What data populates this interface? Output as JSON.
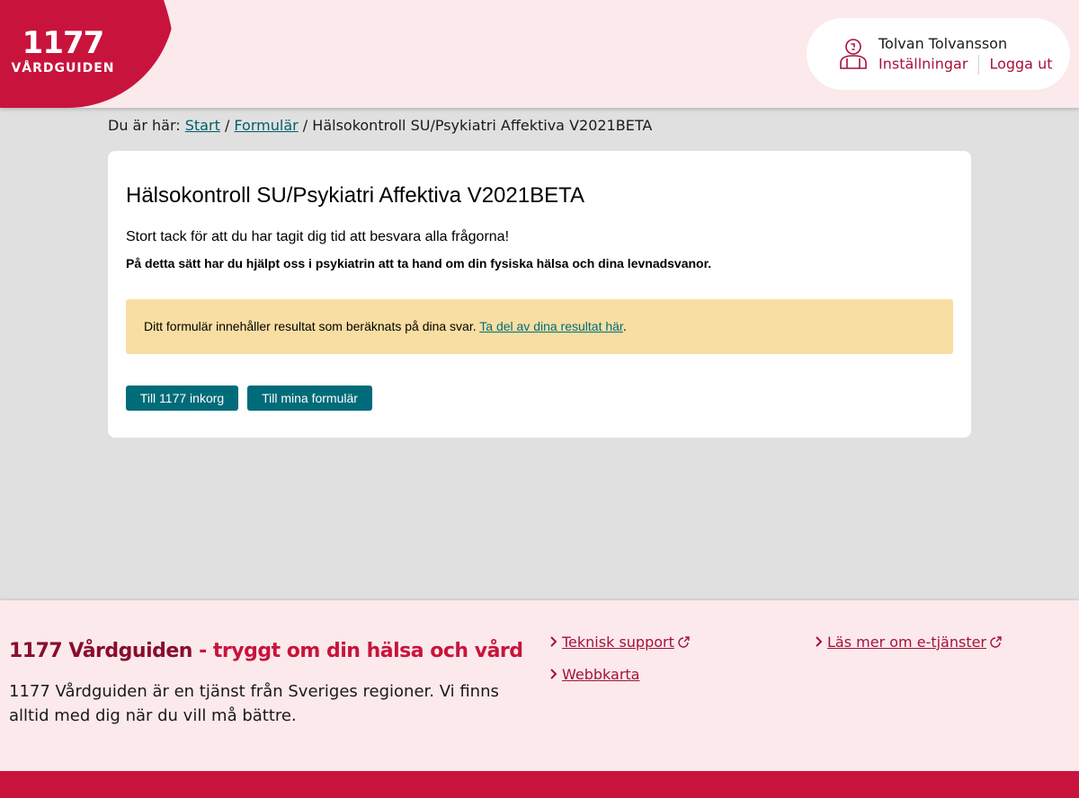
{
  "header": {
    "logo_number": "1177",
    "logo_name": "VÅRDGUIDEN",
    "user": {
      "name": "Tolvan Tolvansson",
      "settings_label": "Inställningar",
      "logout_label": "Logga ut"
    }
  },
  "breadcrumb": {
    "prefix": "Du är här:",
    "items": [
      "Start",
      "Formulär"
    ],
    "separator": "/",
    "current": "Hälsokontroll SU/Psykiatri Affektiva V2021BETA"
  },
  "main": {
    "title": "Hälsokontroll SU/Psykiatri Affektiva V2021BETA",
    "thanks": "Stort tack för att du har tagit dig tid att besvara alla frågorna!",
    "help_text": "På detta sätt har du hjälpt oss i psykiatrin att ta hand om din fysiska hälsa och dina levnadsvanor.",
    "notice": {
      "text": "Ditt formulär innehåller resultat som beräknats på dina svar.",
      "link": "Ta del av dina resultat här",
      "suffix": "."
    },
    "buttons": {
      "inbox": "Till 1177 inkorg",
      "forms": "Till mina formulär"
    }
  },
  "footer": {
    "title_brand": "1177 Vårdguiden",
    "title_tagline": "- tryggt om din hälsa och vård",
    "description": "1177 Vårdguiden är en tjänst från Sveriges regioner. Vi finns alltid med dig när du vill må bättre.",
    "links": {
      "support": "Teknisk support",
      "sitemap": "Webbkarta",
      "eservices": "Läs mer om e-tjänster"
    }
  },
  "colors": {
    "brand_red": "#c8143c",
    "header_bg": "#fbe9ec",
    "teal": "#006b79",
    "notice_bg": "#f8dea2",
    "page_bg": "#e0e0e0"
  },
  "icons": [
    "user-icon",
    "chevron-right-icon",
    "external-link-icon"
  ]
}
